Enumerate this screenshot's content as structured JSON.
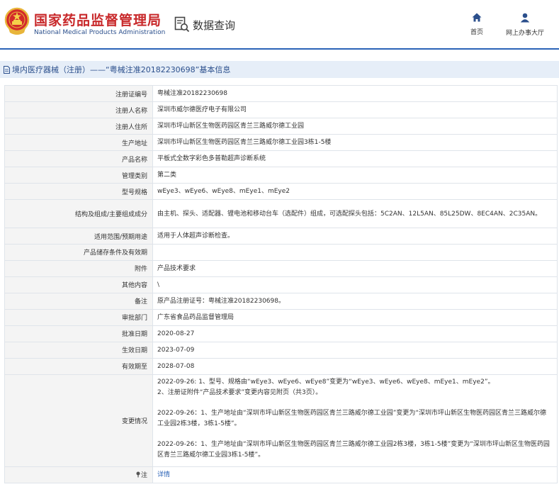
{
  "header": {
    "org_name_cn": "国家药品监督管理局",
    "org_name_en": "National Medical Products Administration",
    "query_label": "数据查询",
    "nav": {
      "home_label": "首页",
      "service_hall_label": "网上办事大厅"
    }
  },
  "section": {
    "title": "境内医疗器械（注册）——“粤械注准20182230698”基本信息"
  },
  "rows": [
    {
      "label": "注册证编号",
      "value": "粤械注准20182230698"
    },
    {
      "label": "注册人名称",
      "value": "深圳市威尔德医疗电子有限公司"
    },
    {
      "label": "注册人住所",
      "value": "深圳市坪山新区生物医药园区青兰三路威尔德工业园"
    },
    {
      "label": "生产地址",
      "value": "深圳市坪山新区生物医药园区青兰三路威尔德工业园3栋1-5楼"
    },
    {
      "label": "产品名称",
      "value": "平板式全数字彩色多普勒超声诊断系统"
    },
    {
      "label": "管理类别",
      "value": "第二类"
    },
    {
      "label": "型号规格",
      "value": "wEye3、wEye6、wEye8、mEye1、mEye2"
    },
    {
      "label": "结构及组成/主要组成成分",
      "value": "由主机、探头、适配器、锂电池和移动台车（选配件）组成，可选配探头包括：5C2AN、12L5AN、85L25DW、8EC4AN、2C35AN。"
    },
    {
      "label": "适用范围/预期用途",
      "value": "适用于人体超声诊断检查。"
    },
    {
      "label": "产品储存条件及有效期",
      "value": ""
    },
    {
      "label": "附件",
      "value": "产品技术要求"
    },
    {
      "label": "其他内容",
      "value": "\\"
    },
    {
      "label": "备注",
      "value": "原产品注册证号：粤械注准20182230698。"
    },
    {
      "label": "审批部门",
      "value": "广东省食品药品监督管理局"
    },
    {
      "label": "批准日期",
      "value": "2020-08-27"
    },
    {
      "label": "生效日期",
      "value": "2023-07-09"
    },
    {
      "label": "有效期至",
      "value": "2028-07-08"
    }
  ],
  "changes": {
    "label": "变更情况",
    "entry1_line1": "2022-09-26: 1、型号、规格由“wEye3、wEye6、wEye8”变更为“wEye3、wEye6、wEye8、mEye1、mEye2”。",
    "entry1_line2": "2、注册证附件“产品技术要求”变更内容见附页（共3页）。",
    "entry2": "2022-09-26：1、生产地址由“深圳市坪山新区生物医药园区青兰三路威尔德工业园”变更为“深圳市坪山新区生物医药园区青兰三路威尔德工业园2栋3楼，3栋1-5楼”。",
    "entry3": "2022-09-26：1、生产地址由“深圳市坪山新区生物医药园区青兰三路威尔德工业园2栋3楼，3栋1-5楼”变更为“深圳市坪山新区生物医药园区青兰三路威尔德工业园3栋1-5楼”。"
  },
  "note": {
    "label": "注",
    "link_text": "详情"
  },
  "colors": {
    "brand_red": "#c8282a",
    "brand_blue": "#2b63b7",
    "section_bg": "#e6eef8"
  },
  "icons": {
    "emblem": "national-emblem-icon",
    "query": "document-search-icon",
    "home": "home-icon",
    "user": "user-icon",
    "section": "document-icon",
    "note": "pin-icon"
  }
}
